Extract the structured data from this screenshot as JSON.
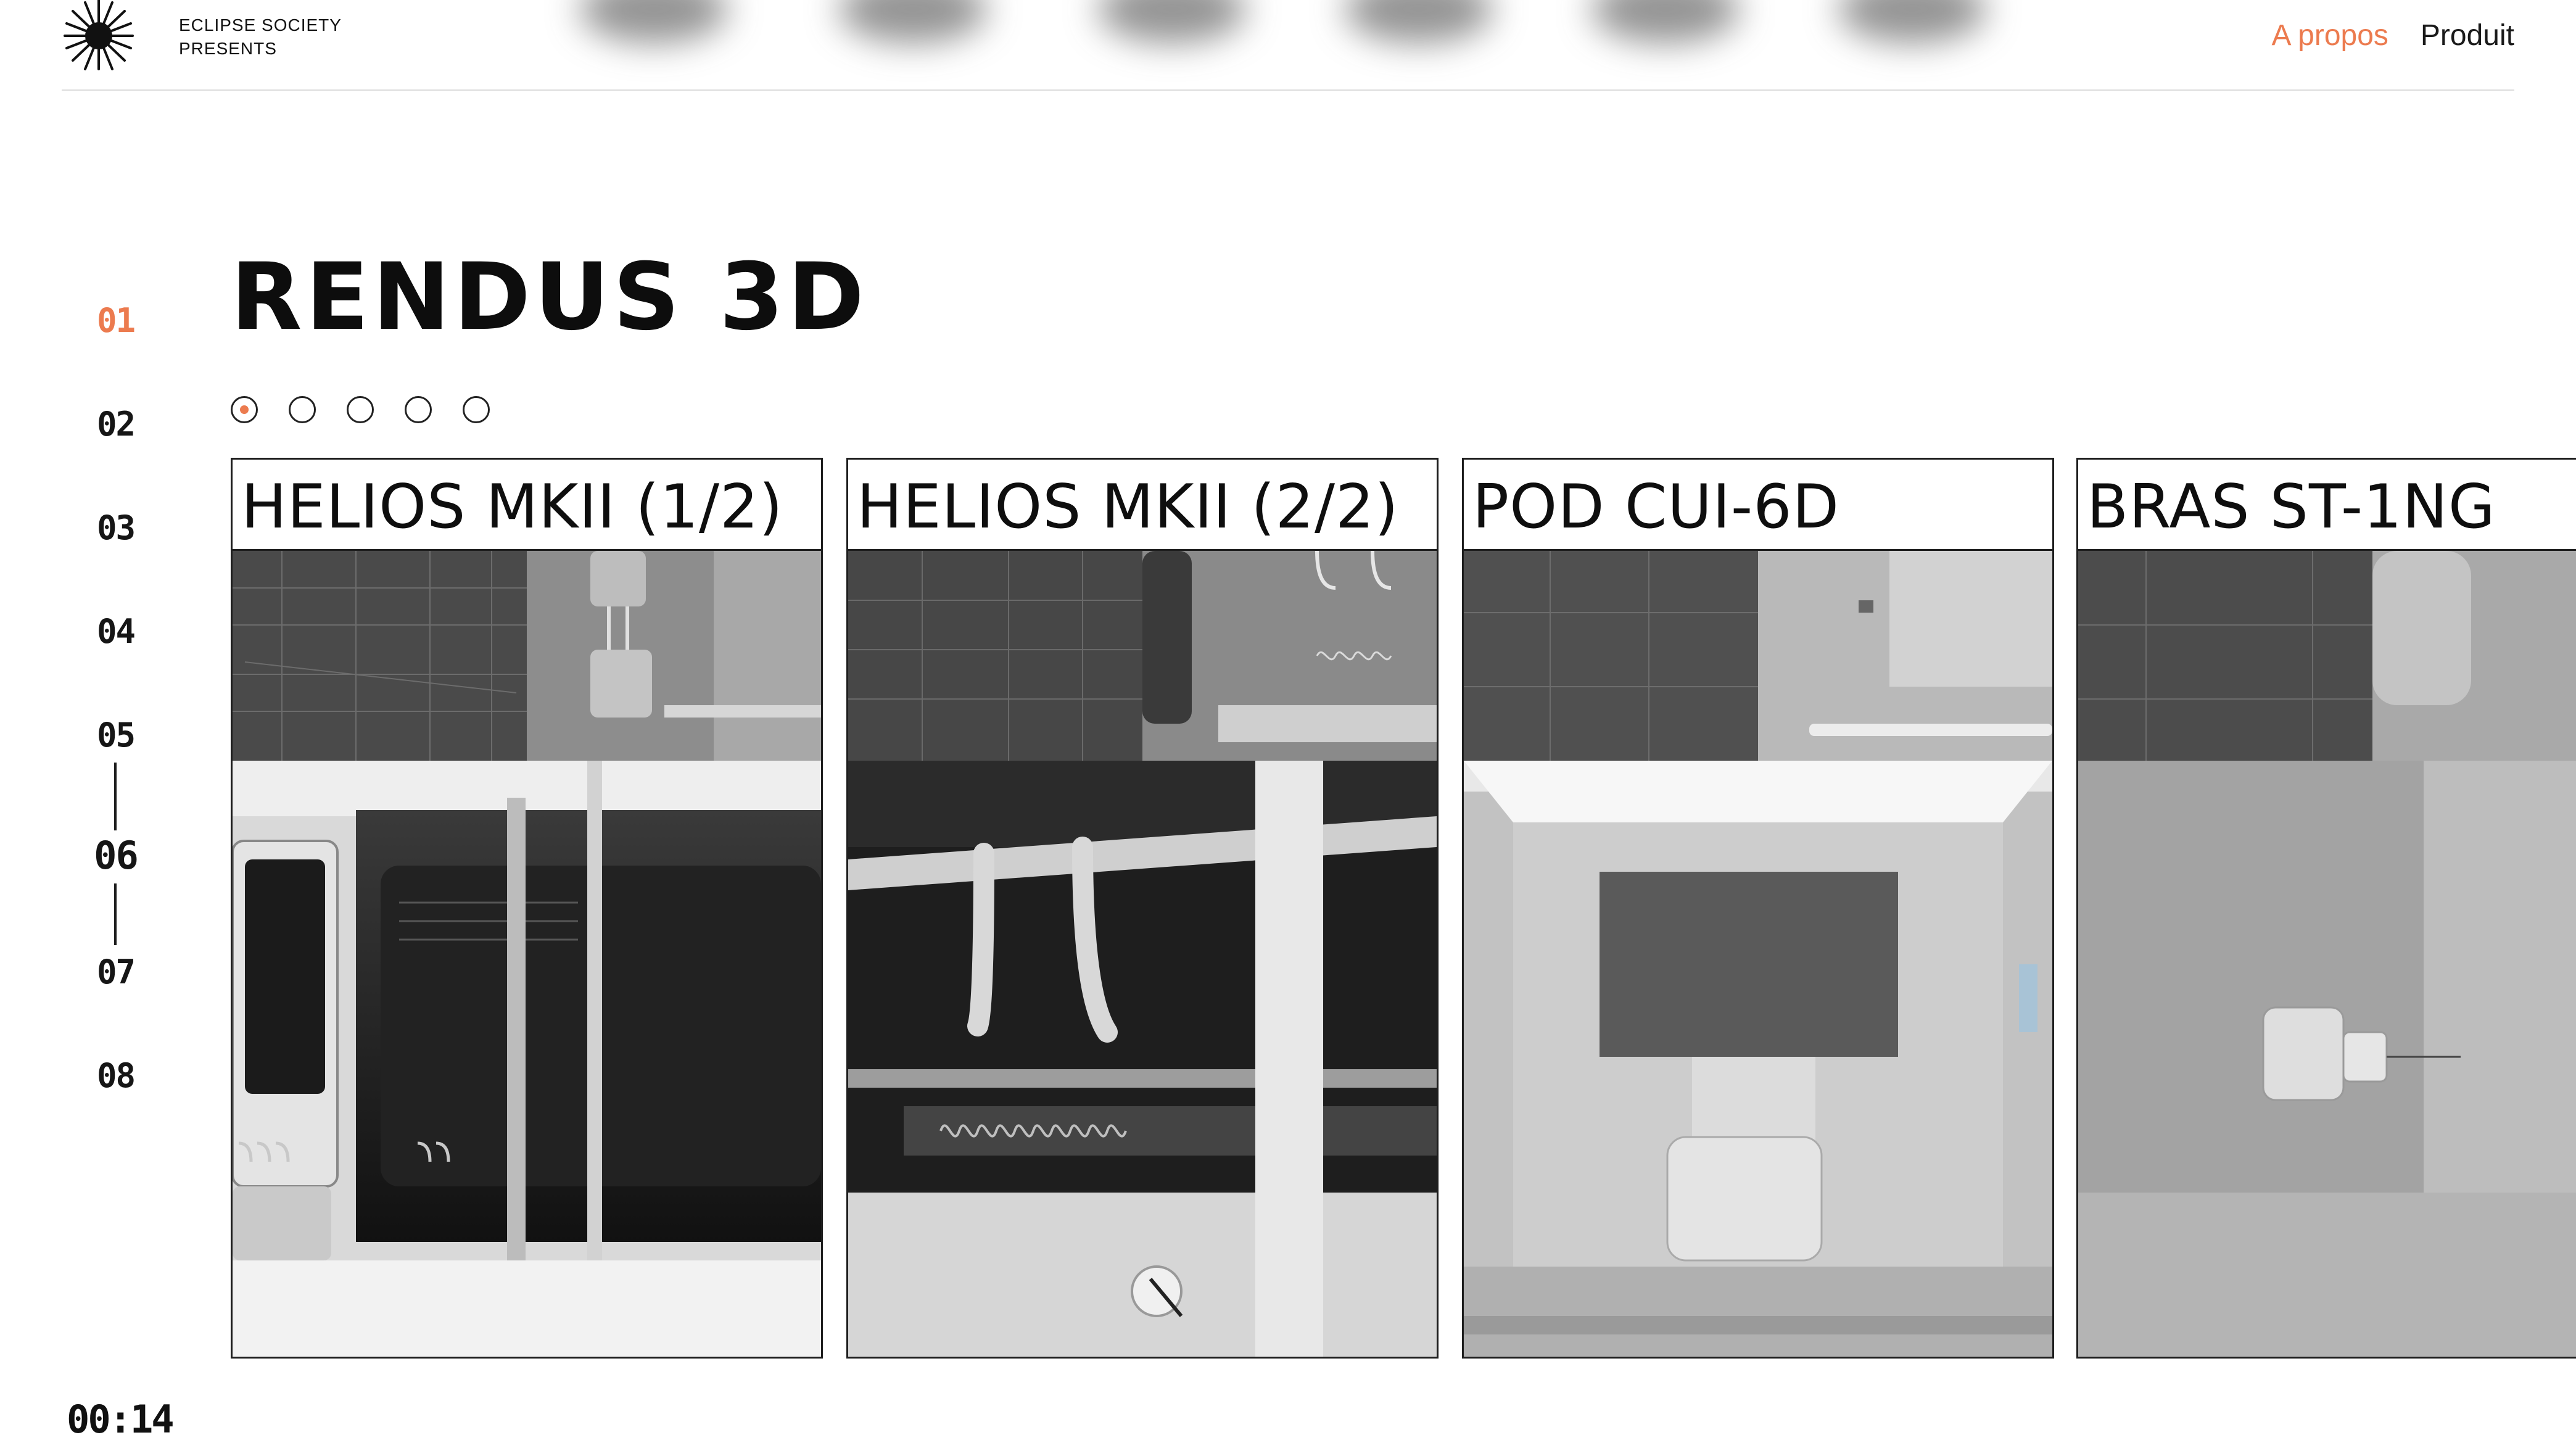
{
  "header": {
    "brand_line1": "ECLIPSE SOCIETY",
    "brand_line2": "PRESENTS",
    "nav": [
      {
        "label": "A propos",
        "active": true
      },
      {
        "label": "Produit",
        "active": false
      }
    ]
  },
  "section_index": {
    "items": [
      "01",
      "02",
      "03",
      "04",
      "05",
      "06",
      "07",
      "08"
    ],
    "active": "01",
    "current": "06"
  },
  "page_title": "RENDUS 3D",
  "carousel": {
    "dot_count": 5,
    "active_dot": 1
  },
  "cards": [
    {
      "title": "HELIOS MKII (1/2)"
    },
    {
      "title": "HELIOS MKII (2/2)"
    },
    {
      "title": "POD CUI-6D"
    },
    {
      "title": "BRAS ST-1NG"
    }
  ],
  "timer": "00:14",
  "colors": {
    "accent": "#ec7b4f",
    "text": "#111111",
    "border": "#1e1e1e"
  },
  "icons": {
    "logo": "eclipse-star-logo-icon"
  }
}
